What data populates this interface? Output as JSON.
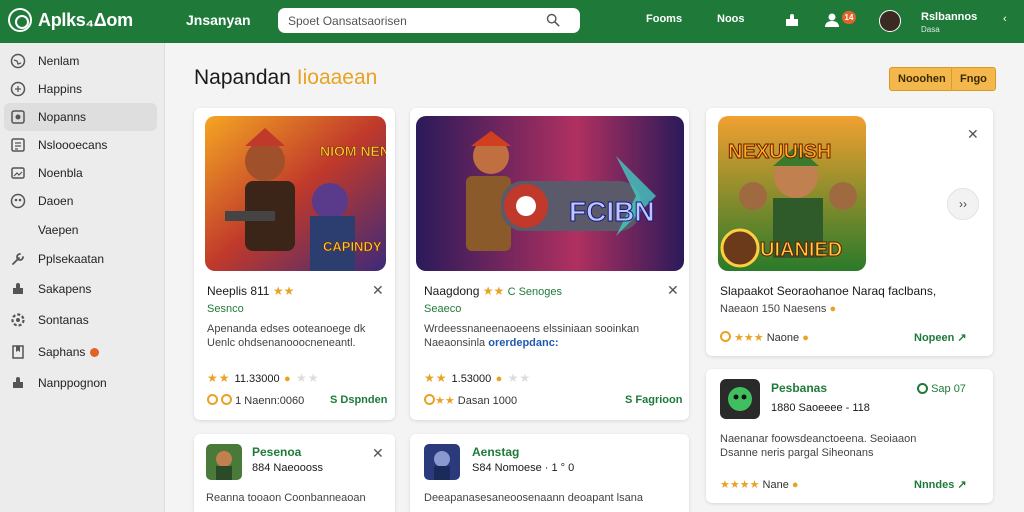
{
  "header": {
    "logo_text": "Aplks₄Δom",
    "app_title": "Jnsanyan",
    "search_placeholder": "Spoet Oansatsaorisen",
    "nav": [
      "Fooms",
      "Noos"
    ],
    "notification_count": "14",
    "user_name": "Rslbannos",
    "user_sub": "Dasa"
  },
  "sidebar": {
    "items": [
      {
        "label": "Nenlam",
        "icon": "globe-icon"
      },
      {
        "label": "Happins",
        "icon": "grid-icon"
      },
      {
        "label": "Nopanns",
        "icon": "image-icon",
        "active": true
      },
      {
        "label": "Nsloooecans",
        "icon": "note-icon"
      },
      {
        "label": "Noenbla",
        "icon": "picture-icon"
      },
      {
        "label": "Daoen",
        "icon": "gamepad-icon"
      },
      {
        "label": "Vaepen",
        "icon": "user-icon"
      },
      {
        "label": "Pplsekaatan",
        "icon": "wrench-icon"
      },
      {
        "label": "Sakapens",
        "icon": "puzzle-icon"
      },
      {
        "label": "Sontanas",
        "icon": "gear-icon"
      },
      {
        "label": "Saphans",
        "icon": "bookmark-icon",
        "dot": true
      },
      {
        "label": "Nanppognon",
        "icon": "puzzle-icon"
      }
    ]
  },
  "main": {
    "heading": "Napandan",
    "heading_accent": "Iioaaean",
    "buttons": [
      "Nooohen",
      "Fngo"
    ],
    "cards": [
      {
        "thumb_text_top": "NIOM NENES",
        "thumb_text_bottom": "CAPINDY",
        "title": "Neeplis 811",
        "meta": "Sesnco",
        "desc": [
          "Apenanda edses ooteanoege dk",
          "Uenlc ohdsenanooocneneantl."
        ],
        "rating_value": "11.33000",
        "footer_left": "1 Naenn:0060",
        "footer_right": "S Dspnden"
      },
      {
        "thumb_text": "FCIBN",
        "title": "Naagdong",
        "title_extra": "C Senoges",
        "meta": "Seaeco",
        "desc": [
          "Wrdeessnaneenaoeens elssiniaan sooinkan",
          "Naeaonsinla"
        ],
        "desc_link": "orerdepdanc:",
        "rating_value": "1.53000",
        "footer_left": "Dasan 1000",
        "footer_right": "S Fagrioon"
      },
      {
        "thumb_text_top": "NEXUUISH",
        "thumb_text_bottom": "UIANIED",
        "title": "Slapaakot Seoraohanoe Naraq faclbans,",
        "meta_text": "Naeaon 150 Naesens",
        "rating_label": "Naone",
        "footer_right": "Nopeen"
      },
      {
        "title": "Pesbanas",
        "meta": "Sap 07",
        "subtitle": "1880 Saoeeee - 118",
        "desc": [
          "Naenanar foowsdeanctoeena. Seoiaaon",
          "Dsanne neris pargal Siheonans"
        ],
        "rating_label": "Nane",
        "footer_right": "Nnndes"
      },
      {
        "title": "Pesenoa",
        "subtitle": "884 Naeoooss",
        "desc": [
          "Reanna tooaon Coonbanneaoan"
        ]
      },
      {
        "title": "Aenstag",
        "subtitle": "S84 Nomoese · 1 ° 0",
        "desc": [
          "Deeapanasesaneoosenaann deoapant lsana"
        ]
      }
    ]
  },
  "colors": {
    "header": "#1f7a3a",
    "accent": "#e9a324",
    "badge": "#e0632a"
  }
}
